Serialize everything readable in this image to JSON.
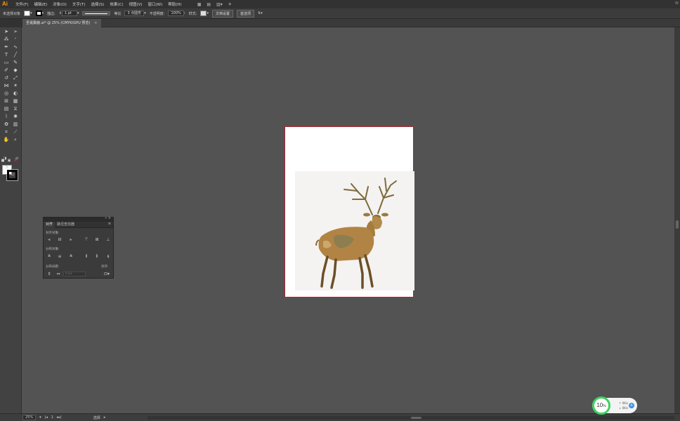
{
  "app": {
    "logo": "Ai"
  },
  "menubar": {
    "items": [
      "文件(F)",
      "编辑(E)",
      "对象(O)",
      "文字(T)",
      "选择(S)",
      "效果(C)",
      "视图(V)",
      "窗口(W)",
      "帮助(H)"
    ],
    "right_label": "W"
  },
  "control": {
    "selection_label": "未选择对象",
    "stroke_label": "描边:",
    "stroke_value": "1 pt",
    "stroke_style": "等比",
    "brush_value": "3 点圆形",
    "opacity_label": "不透明度:",
    "opacity_value": "100%",
    "style_label": "样式:",
    "doc_setup_button": "文档设置",
    "preferences_button": "首选项"
  },
  "document_tab": {
    "title": "圣诞麋鹿.ai* @ 25% (CMYK/GPU 预览)",
    "close": "×"
  },
  "align_panel": {
    "tab_align": "对齐",
    "tab_pathfinder": "路径查找器",
    "align_objects_label": "对齐对象:",
    "distribute_objects_label": "分布对象:",
    "distribute_spacing_label": "分布间距:",
    "align_to_label": "对齐:",
    "spacing_value": "0 px"
  },
  "statusbar": {
    "zoom": "25%",
    "artboard_number": "1",
    "tool_name": "选择"
  },
  "perf_widget": {
    "value": "10",
    "unit": "%",
    "up_speed": "0K/s",
    "down_speed": "0K/s"
  },
  "colors": {
    "artboard_border": "#b2262e",
    "canvas": "#535353",
    "perf_ring": "#3fd061",
    "logo": "#ff9a00"
  }
}
